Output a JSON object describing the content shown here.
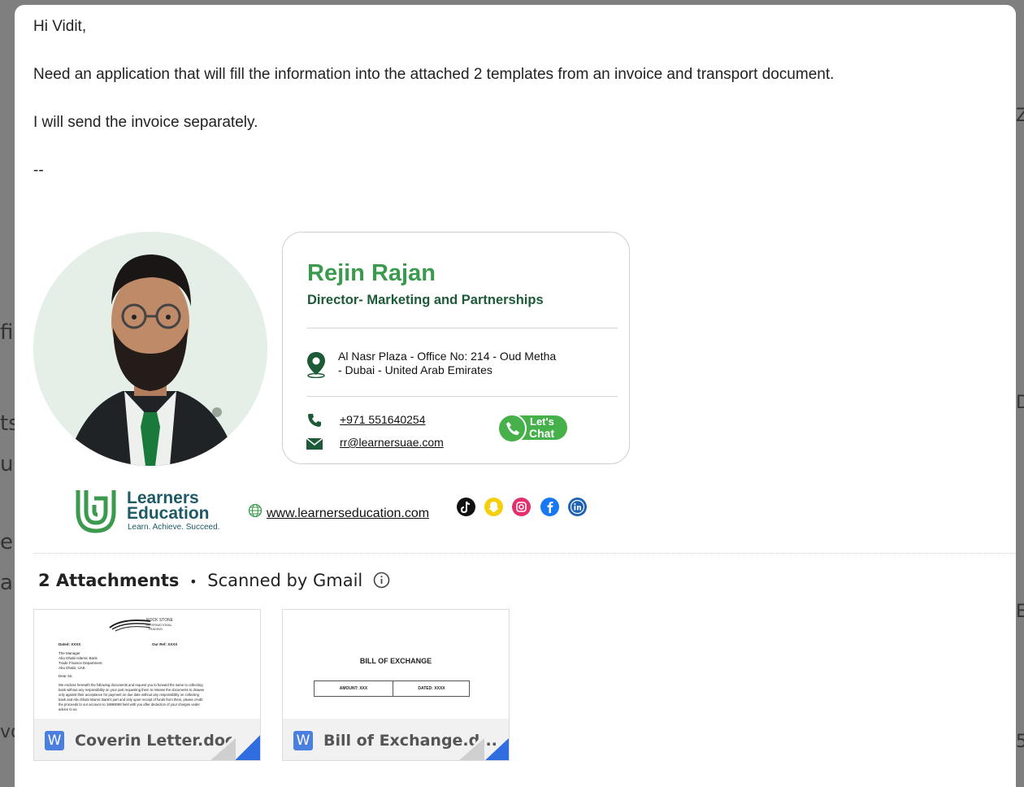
{
  "email": {
    "greeting": "Hi Vidit,",
    "line1": "Need an application that will fill the information into the attached 2 templates from an invoice and transport document.",
    "line2": "I will send the invoice separately.",
    "sig_sep": "--"
  },
  "signature": {
    "name": "Rejin Rajan",
    "title": "Director- Marketing and Partnerships",
    "address_line1": "Al Nasr Plaza - Office No: 214 - Oud Metha",
    "address_line2": "- Dubai - United Arab Emirates",
    "phone": "+971 551640254",
    "email": "rr@learnersuae.com",
    "chat_label_1": "Let's",
    "chat_label_2": "Chat",
    "logo_line1": "Learners",
    "logo_line2": "Education",
    "logo_tagline": "Learn. Achieve. Succeed.",
    "website": "www.learnerseducation.com",
    "social_icons": [
      "tiktok-icon",
      "snapchat-icon",
      "instagram-icon",
      "facebook-icon",
      "linkedin-icon"
    ],
    "brand_color": "#3b9a4e",
    "dark_green": "#1d5a37"
  },
  "attachments": {
    "count_label": "2 Attachments",
    "separator": "•",
    "scanned_label": "Scanned by Gmail",
    "items": [
      {
        "filename": "Coverin Letter.doc",
        "preview": {
          "company": "ROCK STONE",
          "company_sub": "INTERNATIONAL",
          "company_sub2": "TRADING",
          "dated": "Dated: XXXX",
          "our_ref": "Our Ref: XXXX",
          "addr1": "The Manager",
          "addr2": "Abu Dhabi Islamic Bank",
          "addr3": "Trade Finance Department",
          "addr4": "Abu Dhabi, UAE",
          "salutation": "Dear Sir,",
          "body1": "We enclose herewith the following documents and request you to forward the same to collecting",
          "body2": "bank without any responsibility on your part requesting them to release the documents to drawee",
          "body3": "only against their acceptance for payment on due date without any responsibility on collecting",
          "body4": "bank and Abu Dhabi Islamic Bank's part and only upon receipt of funds from them, please credit",
          "body5": "the proceeds to our account no 18868069 held with you after deduction of your charges under",
          "body6": "advice to us."
        }
      },
      {
        "filename": "Bill of Exchange.d...",
        "preview": {
          "title": "BILL OF EXCHANGE",
          "amount": "AMOUNT: XXX",
          "dated": "DATED: XXXX"
        }
      }
    ]
  },
  "background": {
    "frag1": "fil",
    "frag2": "ts",
    "frag3": "ur",
    "frag4": "e",
    "frag5": "a",
    "frag6": "vo",
    "frag_r1": "Z",
    "frag_r2": "D",
    "frag_r3": "E",
    "frag_r4": "5"
  }
}
